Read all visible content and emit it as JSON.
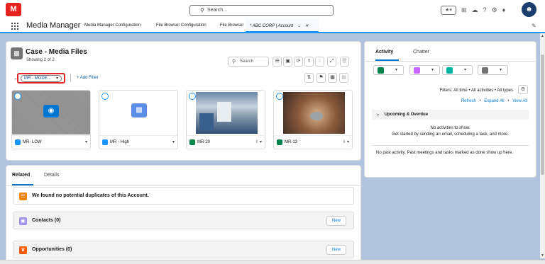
{
  "header": {
    "logo_text": "M",
    "search_placeholder": "Search...",
    "icons": [
      "star-icon",
      "dropdown-icon",
      "add-icon",
      "cloud-icon",
      "help-icon",
      "gear-icon",
      "bell-icon",
      "avatar-icon"
    ]
  },
  "nav": {
    "app_name": "Media Manager",
    "items": [
      "Media Manager Configuration",
      "File Browser Configuration",
      "File Browser"
    ],
    "active_tab": "* ABC CORP | Account"
  },
  "media_files": {
    "title": "Case - Media Files",
    "subtitle": "Showing 2 of 2",
    "search_label": "Search",
    "selector_label": "MR - MODE...",
    "add_filter": "+ Add Filter",
    "tiles": [
      {
        "name": "MR- LOW",
        "kind": "image-placeholder",
        "accent": "#1b96ff"
      },
      {
        "name": "MR - High",
        "kind": "folder",
        "accent": "#1b96ff"
      },
      {
        "name": "MR-20",
        "kind": "photo-factory",
        "accent": "#04844b"
      },
      {
        "name": "MR-13",
        "kind": "photo-hands",
        "accent": "#04844b"
      }
    ]
  },
  "related": {
    "tabs": [
      "Related",
      "Details"
    ],
    "duplicates_text": "We found no potential duplicates of this Account.",
    "contacts_title": "Contacts (0)",
    "opportunities_title": "Opportunities (0)",
    "new_label": "New"
  },
  "activity": {
    "tabs": [
      "Activity",
      "Chatter"
    ],
    "filters_text": "Filters: All time • All activities • All types",
    "refresh": "Refresh",
    "expand_all": "Expand All",
    "view_all": "View All",
    "dot": "•",
    "upcoming": "Upcoming & Overdue",
    "no_activities": "No activities to show.",
    "get_started": "Get started by sending an email, scheduling a task, and more.",
    "no_past": "No past activity. Past meetings and tasks marked as done show up here.",
    "colors": {
      "task": "#04844b",
      "event": "#cb65ff",
      "call": "#00b3a0",
      "email": "#747474"
    }
  }
}
